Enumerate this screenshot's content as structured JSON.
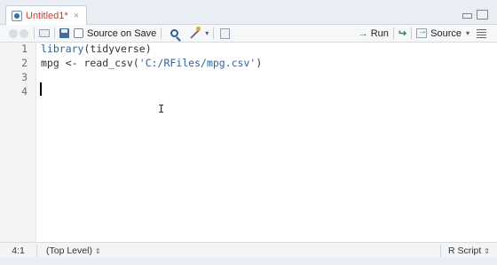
{
  "tab": {
    "title": "Untitled1*",
    "close": "×"
  },
  "toolbar": {
    "source_on_save_label": "Source on Save",
    "run_label": "Run",
    "source_label": "Source",
    "caret": "▾"
  },
  "editor": {
    "line_numbers": [
      "1",
      "2",
      "3",
      "4"
    ],
    "lines": [
      {
        "kw": "library",
        "rest": "(tidyverse)"
      },
      {
        "pre": "mpg <- read_csv(",
        "str": "'C:/RFiles/mpg.csv'",
        "post": ")"
      }
    ],
    "mouse_cursor": "I"
  },
  "status": {
    "position": "4:1",
    "scope": "(Top Level)",
    "file_type": "R Script",
    "updown": "⇕"
  }
}
